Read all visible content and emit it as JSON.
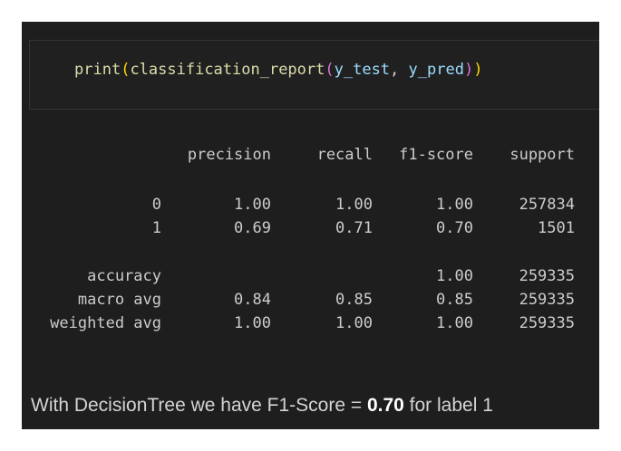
{
  "code": {
    "fn_print": "print",
    "open1": "(",
    "fn_report": "classification_report",
    "open2": "(",
    "arg1": "y_test",
    "sep": ", ",
    "arg2": "y_pred",
    "close2": ")",
    "close1": ")"
  },
  "report": {
    "headers": [
      "",
      "precision",
      "recall",
      "f1-score",
      "support"
    ],
    "rows": [
      [
        "0",
        "1.00",
        "1.00",
        "1.00",
        "257834"
      ],
      [
        "1",
        "0.69",
        "0.71",
        "0.70",
        "1501"
      ],
      [
        "accuracy",
        "",
        "",
        "1.00",
        "259335"
      ],
      [
        "macro avg",
        "0.84",
        "0.85",
        "0.85",
        "259335"
      ],
      [
        "weighted avg",
        "1.00",
        "1.00",
        "1.00",
        "259335"
      ]
    ]
  },
  "summary": {
    "prefix": "With DecisionTree we have F1-Score = ",
    "value": "0.70",
    "suffix": " for label 1"
  },
  "colors": {
    "background": "#1e1e1e",
    "function": "#dcdcaa",
    "variable": "#9cdcfe",
    "paren_outer": "#ffd700",
    "paren_inner": "#da70d6",
    "text": "#cccccc"
  }
}
